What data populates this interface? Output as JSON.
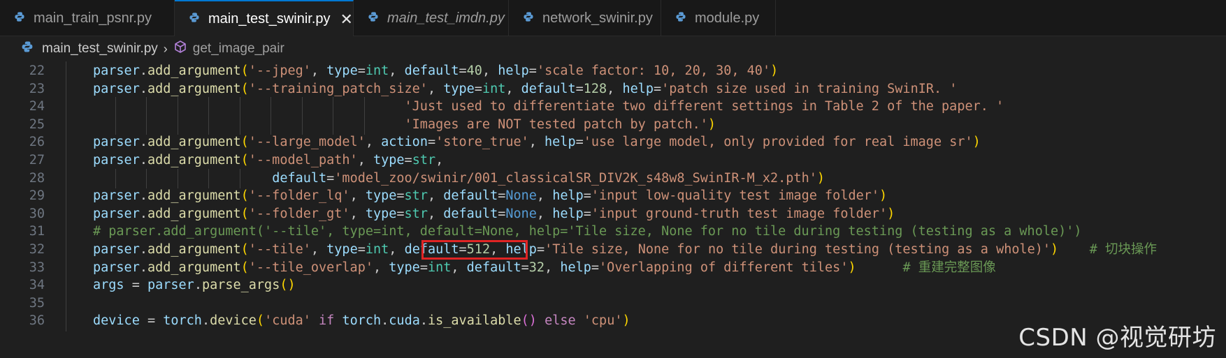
{
  "tabs": [
    {
      "label": "main_train_psnr.py",
      "active": false,
      "italic": false,
      "icon": "python-icon"
    },
    {
      "label": "main_test_swinir.py",
      "active": true,
      "italic": false,
      "icon": "python-icon",
      "close": "✕"
    },
    {
      "label": "main_test_imdn.py",
      "active": false,
      "italic": true,
      "icon": "python-icon"
    },
    {
      "label": "network_swinir.py",
      "active": false,
      "italic": false,
      "icon": "python-icon"
    },
    {
      "label": "module.py",
      "active": false,
      "italic": false,
      "icon": "python-icon"
    }
  ],
  "breadcrumb": {
    "file": "main_test_swinir.py",
    "symbol": "get_image_pair"
  },
  "editor": {
    "lines": [
      {
        "n": "22",
        "g": 1,
        "tokens": [
          [
            "var",
            "parser"
          ],
          [
            "punc",
            "."
          ],
          [
            "fn",
            "add_argument"
          ],
          [
            "par1",
            "("
          ],
          [
            "str",
            "'--jpeg'"
          ],
          [
            "punc",
            ", "
          ],
          [
            "var",
            "type"
          ],
          [
            "punc",
            "="
          ],
          [
            "cls",
            "int"
          ],
          [
            "punc",
            ", "
          ],
          [
            "var",
            "default"
          ],
          [
            "punc",
            "="
          ],
          [
            "num",
            "40"
          ],
          [
            "punc",
            ", "
          ],
          [
            "var",
            "help"
          ],
          [
            "punc",
            "="
          ],
          [
            "str",
            "'scale factor: 10, 20, 30, 40'"
          ],
          [
            "par1",
            ")"
          ]
        ]
      },
      {
        "n": "23",
        "g": 1,
        "tokens": [
          [
            "var",
            "parser"
          ],
          [
            "punc",
            "."
          ],
          [
            "fn",
            "add_argument"
          ],
          [
            "par1",
            "("
          ],
          [
            "str",
            "'--training_patch_size'"
          ],
          [
            "punc",
            ", "
          ],
          [
            "var",
            "type"
          ],
          [
            "punc",
            "="
          ],
          [
            "cls",
            "int"
          ],
          [
            "punc",
            ", "
          ],
          [
            "var",
            "default"
          ],
          [
            "punc",
            "="
          ],
          [
            "num",
            "128"
          ],
          [
            "punc",
            ", "
          ],
          [
            "var",
            "help"
          ],
          [
            "punc",
            "="
          ],
          [
            "str",
            "'patch size used in training SwinIR. '"
          ]
        ]
      },
      {
        "n": "24",
        "g": 10,
        "tokens": [
          [
            "punc",
            "                                        "
          ],
          [
            "str",
            "'Just used to differentiate two different settings in Table 2 of the paper. '"
          ]
        ]
      },
      {
        "n": "25",
        "g": 10,
        "tokens": [
          [
            "punc",
            "                                        "
          ],
          [
            "str",
            "'Images are NOT tested patch by patch.'"
          ],
          [
            "par1",
            ")"
          ]
        ]
      },
      {
        "n": "26",
        "g": 1,
        "tokens": [
          [
            "var",
            "parser"
          ],
          [
            "punc",
            "."
          ],
          [
            "fn",
            "add_argument"
          ],
          [
            "par1",
            "("
          ],
          [
            "str",
            "'--large_model'"
          ],
          [
            "punc",
            ", "
          ],
          [
            "var",
            "action"
          ],
          [
            "punc",
            "="
          ],
          [
            "str",
            "'store_true'"
          ],
          [
            "punc",
            ", "
          ],
          [
            "var",
            "help"
          ],
          [
            "punc",
            "="
          ],
          [
            "str",
            "'use large model, only provided for real image sr'"
          ],
          [
            "par1",
            ")"
          ]
        ]
      },
      {
        "n": "27",
        "g": 1,
        "tokens": [
          [
            "var",
            "parser"
          ],
          [
            "punc",
            "."
          ],
          [
            "fn",
            "add_argument"
          ],
          [
            "par1",
            "("
          ],
          [
            "str",
            "'--model_path'"
          ],
          [
            "punc",
            ", "
          ],
          [
            "var",
            "type"
          ],
          [
            "punc",
            "="
          ],
          [
            "cls",
            "str"
          ],
          [
            "punc",
            ","
          ]
        ]
      },
      {
        "n": "28",
        "g": 6,
        "tokens": [
          [
            "punc",
            "                       "
          ],
          [
            "var",
            "default"
          ],
          [
            "punc",
            "="
          ],
          [
            "str",
            "'model_zoo/swinir/001_classicalSR_DIV2K_s48w8_SwinIR-M_x2.pth'"
          ],
          [
            "par1",
            ")"
          ]
        ]
      },
      {
        "n": "29",
        "g": 1,
        "tokens": [
          [
            "var",
            "parser"
          ],
          [
            "punc",
            "."
          ],
          [
            "fn",
            "add_argument"
          ],
          [
            "par1",
            "("
          ],
          [
            "str",
            "'--folder_lq'"
          ],
          [
            "punc",
            ", "
          ],
          [
            "var",
            "type"
          ],
          [
            "punc",
            "="
          ],
          [
            "cls",
            "str"
          ],
          [
            "punc",
            ", "
          ],
          [
            "var",
            "default"
          ],
          [
            "punc",
            "="
          ],
          [
            "cons",
            "None"
          ],
          [
            "punc",
            ", "
          ],
          [
            "var",
            "help"
          ],
          [
            "punc",
            "="
          ],
          [
            "str",
            "'input low-quality test image folder'"
          ],
          [
            "par1",
            ")"
          ]
        ]
      },
      {
        "n": "30",
        "g": 1,
        "tokens": [
          [
            "var",
            "parser"
          ],
          [
            "punc",
            "."
          ],
          [
            "fn",
            "add_argument"
          ],
          [
            "par1",
            "("
          ],
          [
            "str",
            "'--folder_gt'"
          ],
          [
            "punc",
            ", "
          ],
          [
            "var",
            "type"
          ],
          [
            "punc",
            "="
          ],
          [
            "cls",
            "str"
          ],
          [
            "punc",
            ", "
          ],
          [
            "var",
            "default"
          ],
          [
            "punc",
            "="
          ],
          [
            "cons",
            "None"
          ],
          [
            "punc",
            ", "
          ],
          [
            "var",
            "help"
          ],
          [
            "punc",
            "="
          ],
          [
            "str",
            "'input ground-truth test image folder'"
          ],
          [
            "par1",
            ")"
          ]
        ]
      },
      {
        "n": "31",
        "g": 1,
        "tokens": [
          [
            "com",
            "# parser.add_argument('--tile', type=int, default=None, help='Tile size, None for no tile during testing (testing as a whole)')"
          ]
        ]
      },
      {
        "n": "32",
        "g": 1,
        "tokens": [
          [
            "var",
            "parser"
          ],
          [
            "punc",
            "."
          ],
          [
            "fn",
            "add_argument"
          ],
          [
            "par1",
            "("
          ],
          [
            "str",
            "'--tile'"
          ],
          [
            "punc",
            ", "
          ],
          [
            "var",
            "type"
          ],
          [
            "punc",
            "="
          ],
          [
            "cls",
            "int"
          ],
          [
            "punc",
            ", "
          ],
          [
            "var",
            "default"
          ],
          [
            "punc",
            "="
          ],
          [
            "num",
            "512"
          ],
          [
            "punc",
            ", "
          ],
          [
            "var",
            "help"
          ],
          [
            "punc",
            "="
          ],
          [
            "str",
            "'Tile size, None for no tile during testing (testing as a whole)'"
          ],
          [
            "par1",
            ")"
          ],
          [
            "punc",
            "    "
          ],
          [
            "com",
            "# 切块操作"
          ]
        ]
      },
      {
        "n": "33",
        "g": 1,
        "tokens": [
          [
            "var",
            "parser"
          ],
          [
            "punc",
            "."
          ],
          [
            "fn",
            "add_argument"
          ],
          [
            "par1",
            "("
          ],
          [
            "str",
            "'--tile_overlap'"
          ],
          [
            "punc",
            ", "
          ],
          [
            "var",
            "type"
          ],
          [
            "punc",
            "="
          ],
          [
            "cls",
            "int"
          ],
          [
            "punc",
            ", "
          ],
          [
            "var",
            "default"
          ],
          [
            "punc",
            "="
          ],
          [
            "num",
            "32"
          ],
          [
            "punc",
            ", "
          ],
          [
            "var",
            "help"
          ],
          [
            "punc",
            "="
          ],
          [
            "str",
            "'Overlapping of different tiles'"
          ],
          [
            "par1",
            ")"
          ],
          [
            "punc",
            "      "
          ],
          [
            "com",
            "# 重建完整图像"
          ]
        ]
      },
      {
        "n": "34",
        "g": 1,
        "tokens": [
          [
            "var",
            "args"
          ],
          [
            "punc",
            " = "
          ],
          [
            "var",
            "parser"
          ],
          [
            "punc",
            "."
          ],
          [
            "fn",
            "parse_args"
          ],
          [
            "par1",
            "()"
          ]
        ]
      },
      {
        "n": "35",
        "g": 1,
        "tokens": []
      },
      {
        "n": "36",
        "g": 1,
        "tokens": [
          [
            "var",
            "device"
          ],
          [
            "punc",
            " = "
          ],
          [
            "var",
            "torch"
          ],
          [
            "punc",
            "."
          ],
          [
            "fn",
            "device"
          ],
          [
            "par1",
            "("
          ],
          [
            "str",
            "'cuda'"
          ],
          [
            "punc",
            " "
          ],
          [
            "kw",
            "if"
          ],
          [
            "punc",
            " "
          ],
          [
            "var",
            "torch"
          ],
          [
            "punc",
            "."
          ],
          [
            "var",
            "cuda"
          ],
          [
            "punc",
            "."
          ],
          [
            "fn",
            "is_available"
          ],
          [
            "par2",
            "()"
          ],
          [
            "punc",
            " "
          ],
          [
            "kw",
            "else"
          ],
          [
            "punc",
            " "
          ],
          [
            "str",
            "'cpu'"
          ],
          [
            "par1",
            ")"
          ]
        ]
      }
    ]
  },
  "highlight": {
    "line": "32",
    "text": "default=512,"
  },
  "watermark": "CSDN @视觉研坊",
  "colors": {
    "accent": "#0078d4",
    "highlight_border": "#e02424",
    "background": "#1f1f1f"
  }
}
